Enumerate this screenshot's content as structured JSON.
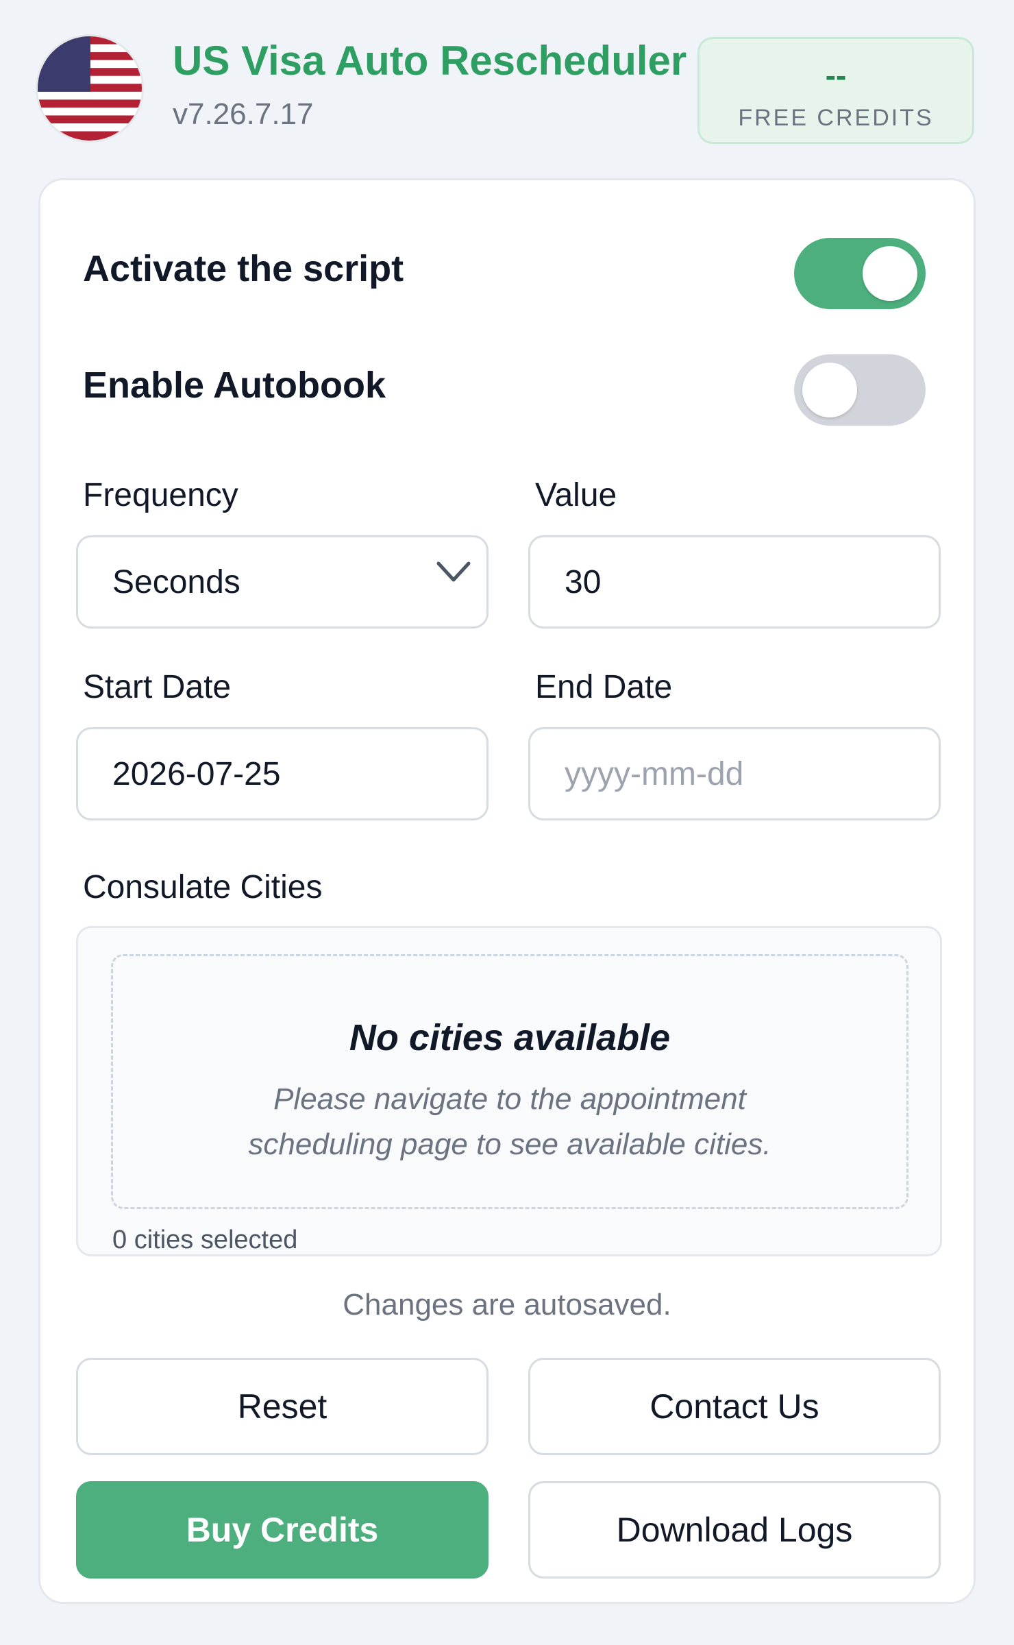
{
  "header": {
    "title": "US Visa Auto Rescheduler",
    "version": "v7.26.7.17",
    "flag_icon": "us-flag-icon",
    "credits": {
      "value": "--",
      "label": "FREE CREDITS"
    }
  },
  "settings": {
    "activate_script": {
      "label": "Activate the script",
      "enabled": true
    },
    "enable_autobook": {
      "label": "Enable Autobook",
      "enabled": false
    }
  },
  "form": {
    "frequency": {
      "label": "Frequency",
      "value": "Seconds",
      "icon": "chevron-down-icon"
    },
    "value": {
      "label": "Value",
      "value": "30"
    },
    "start_date": {
      "label": "Start Date",
      "value": "2026-07-25"
    },
    "end_date": {
      "label": "End Date",
      "value": "",
      "placeholder": "yyyy-mm-dd"
    }
  },
  "cities": {
    "label": "Consulate Cities",
    "empty_title": "No cities available",
    "empty_text_line1": "Please navigate to the appointment",
    "empty_text_line2": "scheduling page to see available cities.",
    "selected_count": "0 cities selected"
  },
  "autosave_note": "Changes are autosaved.",
  "buttons": {
    "reset": "Reset",
    "contact": "Contact Us",
    "buy_credits": "Buy Credits",
    "download_logs": "Download Logs"
  },
  "colors": {
    "brand_green": "#2f9e62",
    "toggle_on": "#4caf7d",
    "toggle_off": "#d1d5db",
    "background": "#f0f4f8"
  }
}
